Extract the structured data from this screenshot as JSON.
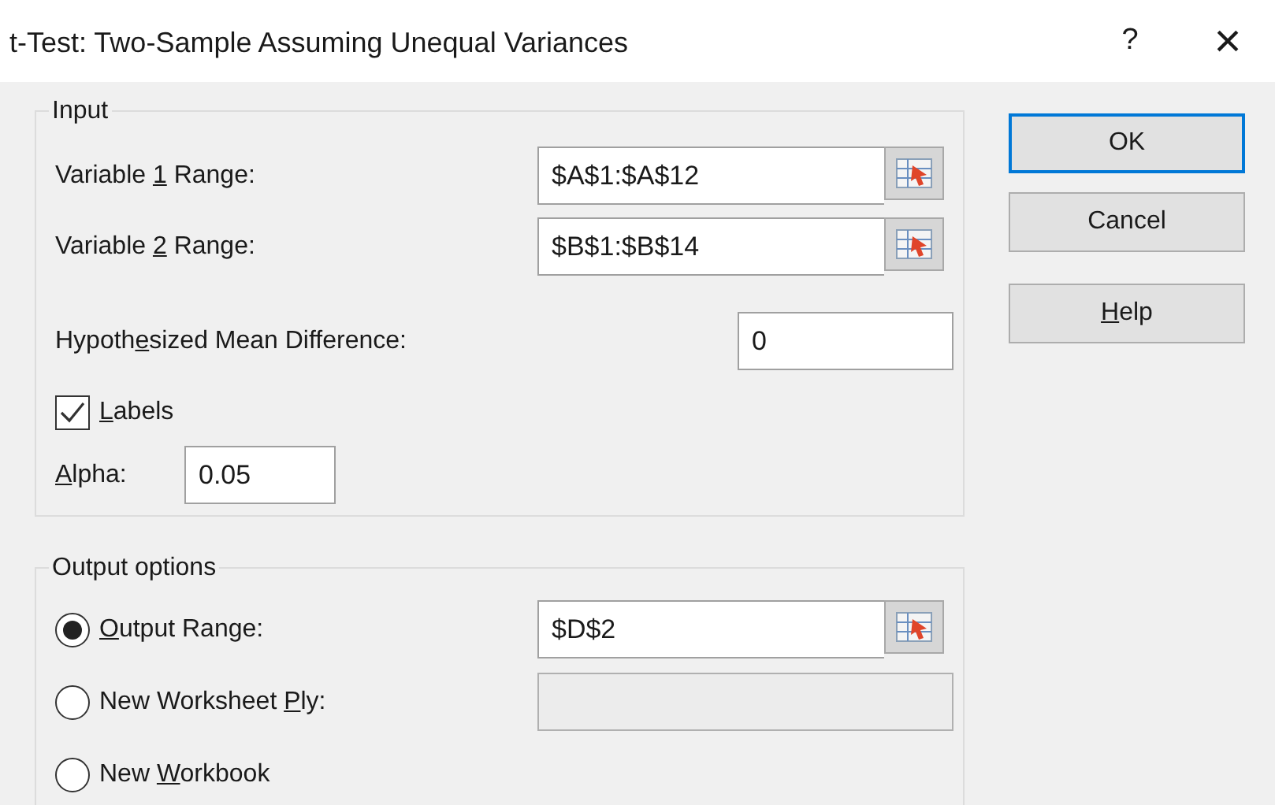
{
  "window": {
    "title": "t-Test: Two-Sample Assuming Unequal Variances",
    "help_glyph": "?",
    "close_glyph": "×"
  },
  "input": {
    "legend": "Input",
    "variable_1": {
      "label": {
        "before": "Variable ",
        "key": "1",
        "after": " Range:"
      },
      "value": "$A$1:$A$12"
    },
    "variable_2": {
      "label": {
        "before": "Variable ",
        "key": "2",
        "after": " Range:"
      },
      "value": "$B$1:$B$14"
    },
    "mean_difference": {
      "label": {
        "before": "Hypoth",
        "key": "e",
        "after": "sized Mean Difference:"
      },
      "value": "0"
    },
    "labels": {
      "label": {
        "key": "L",
        "after": "abels"
      },
      "checked": true
    },
    "alpha": {
      "label": {
        "key": "A",
        "after": "lpha:"
      },
      "value": "0.05"
    }
  },
  "output": {
    "legend": "Output options",
    "options": [
      {
        "label": {
          "key": "O",
          "after": "utput Range:"
        },
        "selected": true,
        "value": "$D$2",
        "disabled": false
      },
      {
        "label": {
          "before": "New Worksheet ",
          "key": "P",
          "after": "ly:"
        },
        "selected": false,
        "disabled": true
      },
      {
        "label": {
          "before": "New ",
          "key": "W",
          "after": "orkbook"
        },
        "selected": false
      }
    ]
  },
  "buttons": [
    {
      "label": {
        "before": "OK"
      },
      "default": true
    },
    {
      "label": {
        "before": "Cancel"
      },
      "default": false
    },
    {
      "label": {
        "key": "H",
        "after": "elp"
      },
      "default": false
    }
  ]
}
